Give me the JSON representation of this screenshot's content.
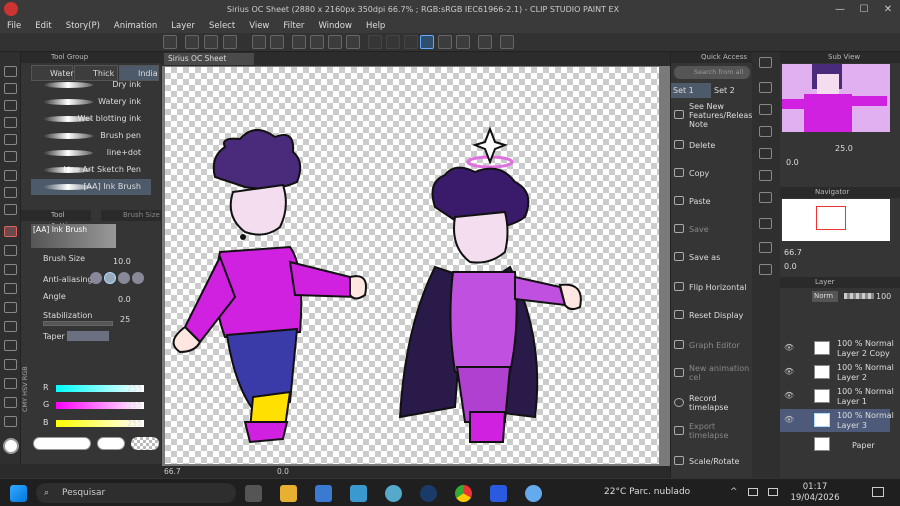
{
  "titlebar": {
    "title": "Sirius OC Sheet (2880 x 2160px 350dpi 66.7% ; RGB:sRGB IEC61966-2.1) - CLIP STUDIO PAINT EX",
    "minimize": "—",
    "maximize": "☐",
    "close": "✕"
  },
  "menu": [
    "File",
    "Edit",
    "Story(P)",
    "Animation",
    "Layer",
    "Select",
    "View",
    "Filter",
    "Window",
    "Help"
  ],
  "left": {
    "tool_group_title": "Tool Group",
    "subtabs": [
      "Water",
      "Thick",
      "India"
    ],
    "brushes": [
      "Dry ink",
      "Watery ink",
      "Wet blotting ink",
      "Brush pen",
      "line+dot",
      "Line Art Sketch Pen",
      "[AA] Ink Brush"
    ],
    "tool_settings_title": "Tool Settings",
    "brush_size_tab": "Brush Size",
    "current_brush": "[AA] Ink Brush",
    "props": {
      "brush_size_label": "Brush Size",
      "brush_size_value": "10.0",
      "antialias_label": "Anti-aliasing",
      "angle_label": "Angle",
      "angle_value": "0.0",
      "stab_label": "Stabilization",
      "stab_value": "25",
      "taper_label": "Taper"
    },
    "color_side_label": "CMY HSV RGB",
    "rgb": [
      {
        "label": "R",
        "value": "255"
      },
      {
        "label": "G",
        "value": "255"
      },
      {
        "label": "B",
        "value": "255"
      }
    ]
  },
  "canvas": {
    "doc_tab": "Sirius OC Sheet",
    "zoom": "66.7",
    "angle": "0.0"
  },
  "quick_access": {
    "title": "Quick Access",
    "search_placeholder": "Search from all",
    "set1": "Set 1",
    "set2": "Set 2",
    "items": [
      {
        "label": "See New Features/Release Note",
        "enabled": true
      },
      {
        "label": "Delete",
        "enabled": true
      },
      {
        "label": "Copy",
        "enabled": true
      },
      {
        "label": "Paste",
        "enabled": true
      },
      {
        "label": "Save",
        "enabled": false
      },
      {
        "label": "Save as",
        "enabled": true
      },
      {
        "label": "Flip Horizontal",
        "enabled": true
      },
      {
        "label": "Reset Display",
        "enabled": true
      },
      {
        "label": "Graph Editor",
        "enabled": false
      },
      {
        "label": "New animation cel",
        "enabled": false
      },
      {
        "label": "Record timelapse",
        "enabled": true
      },
      {
        "label": "Export timelapse",
        "enabled": false
      },
      {
        "label": "Scale/Rotate",
        "enabled": true
      }
    ]
  },
  "right": {
    "subview_title": "Sub View",
    "subview_zoom": "25.0",
    "subview_angle": "0.0",
    "navigator_title": "Navigator",
    "nav_zoom": "66.7",
    "nav_angle": "0.0",
    "layer_title": "Layer",
    "blend_mode": "Norm",
    "opacity": "100",
    "layers": [
      {
        "name": "100 % Normal\nLayer 2 Copy"
      },
      {
        "name": "100 % Normal\nLayer 2"
      },
      {
        "name": "100 % Normal\nLayer 1"
      },
      {
        "name": "100 % Normal\nLayer 3",
        "selected": true
      },
      {
        "name": "Paper"
      }
    ]
  },
  "taskbar": {
    "search": "Pesquisar",
    "weather": "22°C  Parc. nublado",
    "time": "01:17",
    "date": "19/04/2026"
  }
}
